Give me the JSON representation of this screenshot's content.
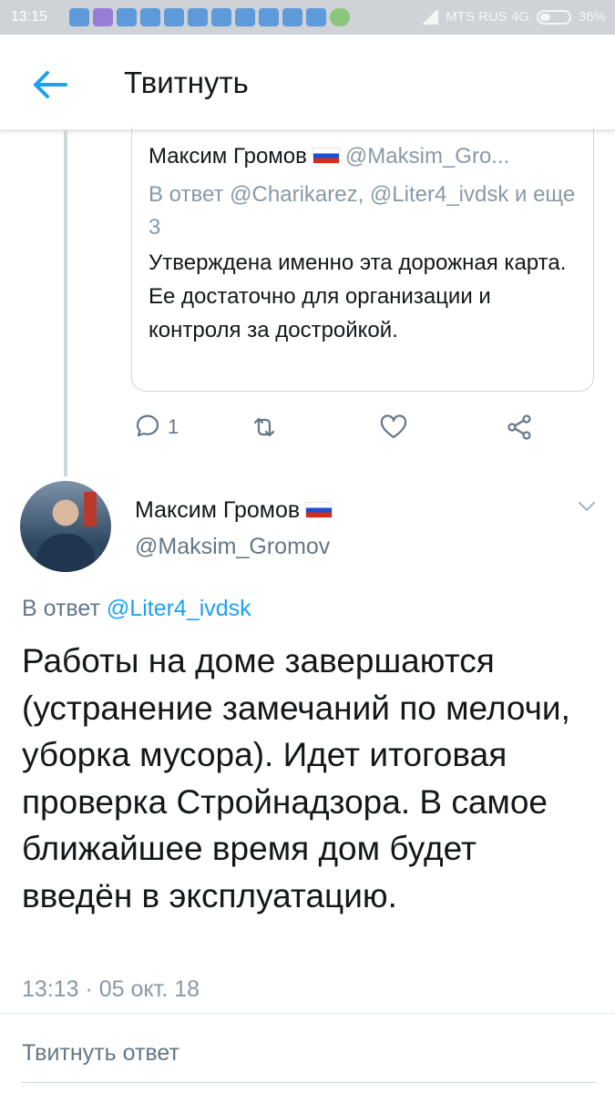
{
  "status_bar": {
    "time": "13:15",
    "carrier": "MTS RUS 4G",
    "battery": "36%"
  },
  "app_bar": {
    "title": "Твитнуть",
    "back_icon": "arrow-left-icon"
  },
  "quoted_tweet": {
    "author_name": "Максим Громов",
    "author_handle": "@Maksim_Gro...",
    "reply_to": "В ответ @Charikarez, @Liter4_ivdsk и еще 3",
    "text": "Утверждена именно эта дорожная карта. Ее достаточно для организации и контроля за достройкой.",
    "actions": {
      "reply_count": "1"
    }
  },
  "tweet": {
    "author_name": "Максим Громов",
    "author_handle": "@Maksim_Gromov",
    "reply_prefix": "В ответ",
    "reply_link": "@Liter4_ivdsk",
    "text": "Работы на доме завершаются (устранение замечаний по мелочи, уборка мусора). Идет итоговая проверка Стройнадзора. В самое ближайшее время дом будет введён в эксплуатацию.",
    "timestamp": "13:13 · 05 окт. 18"
  },
  "reply_box": {
    "placeholder": "Твитнуть ответ"
  },
  "colors": {
    "accent": "#1da1f2",
    "muted": "#8899a6",
    "text": "#14171a"
  }
}
